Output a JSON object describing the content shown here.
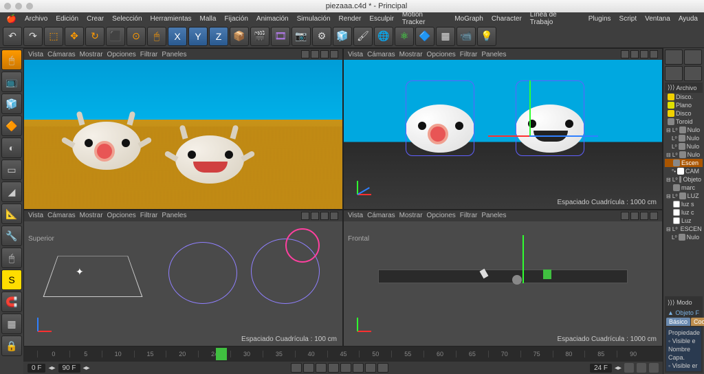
{
  "titlebar": {
    "title": "piezaaa.c4d * - Principal"
  },
  "menubar": [
    "Archivo",
    "Edición",
    "Crear",
    "Selección",
    "Herramientas",
    "Malla",
    "Fijación",
    "Animación",
    "Simulación",
    "Render",
    "Esculpir",
    "Motion Tracker",
    "MoGraph",
    "Character",
    "Línea de Trabajo",
    "Plugins",
    "Script",
    "Ventana",
    "Ayuda"
  ],
  "toolbar_icons": [
    "↶",
    "↷",
    "⬚",
    "✥",
    "↻",
    "⬛",
    "⊙",
    "🖱",
    "X",
    "Y",
    "Z",
    "📦",
    "🎬",
    "🎞",
    "📷",
    "⚙",
    "🧊",
    "🖌",
    "🌐",
    "⚛",
    "🔷",
    "▦",
    "📹",
    "💡"
  ],
  "left_tools": [
    "🖱",
    "📺",
    "🧊",
    "🔶",
    "◐",
    "▭",
    "◢",
    "📐",
    "🔧",
    "🖱",
    "S",
    "🧲",
    "▦",
    "🔒"
  ],
  "viewport_menu": [
    "Vista",
    "Cámaras",
    "Mostrar",
    "Opciones",
    "Filtrar",
    "Paneles"
  ],
  "vp": {
    "top_label": "Superior",
    "front_label": "Frontal",
    "grid_1000": "Espaciado Cuadrícula : 1000 cm",
    "grid_100": "Espaciado Cuadrícula : 100 cm"
  },
  "timeline": {
    "ticks": [
      "0",
      "5",
      "10",
      "15",
      "20",
      "24",
      "30",
      "35",
      "40",
      "45",
      "50",
      "55",
      "60",
      "65",
      "70",
      "75",
      "80",
      "85",
      "90"
    ],
    "start": "0 F",
    "end": "90 F",
    "current": "24 F"
  },
  "right": {
    "archivo": "Archivo",
    "tree": [
      {
        "icon": "ti-disc",
        "label": "Disco."
      },
      {
        "icon": "ti-plane",
        "label": "Plano"
      },
      {
        "icon": "ti-disc",
        "label": "Disco"
      },
      {
        "icon": "ti-null",
        "label": "Toroid"
      },
      {
        "icon": "ti-null",
        "label": "Nulo",
        "prefix": "⊟ L⁰"
      },
      {
        "icon": "ti-null",
        "label": "Nulo",
        "prefix": "L⁰",
        "indent": 1
      },
      {
        "icon": "ti-null",
        "label": "Nulo",
        "prefix": "L⁰",
        "indent": 1
      },
      {
        "icon": "ti-null",
        "label": "Nulo",
        "prefix": "⊟ L⁰"
      },
      {
        "icon": "ti-null",
        "label": "Escen",
        "prefix": "",
        "sel": true,
        "indent": 1
      },
      {
        "icon": "ti-cam",
        "label": "CAM",
        "prefix": "°•",
        "indent": 1
      },
      {
        "icon": "ti-null",
        "label": "Objeto",
        "prefix": "⊟ L⁰"
      },
      {
        "icon": "ti-null",
        "label": "marc",
        "indent": 1
      },
      {
        "icon": "ti-null",
        "label": "LUZ",
        "prefix": "⊟ L⁰"
      },
      {
        "icon": "ti-light",
        "label": "luz s",
        "indent": 1
      },
      {
        "icon": "ti-light",
        "label": "luz c",
        "indent": 1
      },
      {
        "icon": "ti-light",
        "label": "Luz",
        "indent": 1
      },
      {
        "icon": "ti-null",
        "label": "ESCEN",
        "prefix": "⊟ L⁰"
      },
      {
        "icon": "ti-null",
        "label": "Nulo",
        "prefix": "L⁰",
        "indent": 1
      }
    ],
    "modo": "Modo",
    "objeto": "Objeto F",
    "basico": "Básico",
    "coord": "Coo",
    "propiedades": "Propiedade",
    "visible": "Visible e",
    "nombre": "Nombre",
    "capa": "Capa.",
    "visible_en": "Visible er"
  }
}
